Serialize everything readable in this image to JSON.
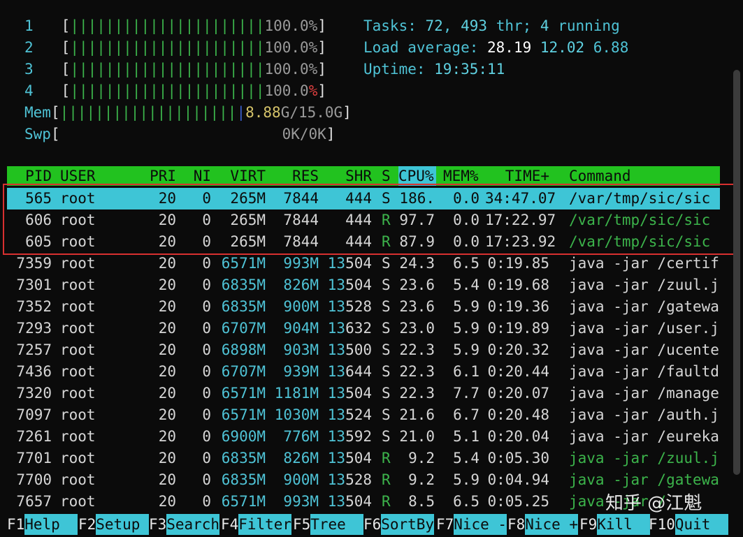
{
  "cpus": [
    {
      "label": "1",
      "bar": "||||||||||||||||||||||",
      "pct": "100.0%"
    },
    {
      "label": "2",
      "bar": "||||||||||||||||||||||",
      "pct": "100.0%"
    },
    {
      "label": "3",
      "bar": "||||||||||||||||||||||",
      "pct": "100.0%"
    },
    {
      "label": "4",
      "bar": "||||||||||||||||||||||",
      "pct_num": "100.0",
      "pct_sign": "%"
    }
  ],
  "mem": {
    "label": "Mem",
    "bar": "||||||||||||||||||||",
    "used": "8.88",
    "total": "G/15.0G"
  },
  "swp": {
    "label": "Swp",
    "value": "0K/0K"
  },
  "stats": {
    "tasks_label": "Tasks: ",
    "tasks": "72",
    "comma": ", ",
    "threads": "493",
    "thr_label": " thr; ",
    "running": "4",
    "running_label": " running",
    "load_label": "Load average: ",
    "load1": "28.19",
    "load5": "12.02",
    "load15": "6.88",
    "uptime_label": "Uptime: ",
    "uptime": "19:35:11"
  },
  "columns": [
    "PID",
    "USER",
    "PRI",
    "NI",
    "VIRT",
    "RES",
    "SHR",
    "S",
    "CPU%",
    "MEM%",
    "TIME+",
    "Command"
  ],
  "processes": [
    {
      "pid": "565",
      "user": "root",
      "pri": "20",
      "ni": "0",
      "virt": "265M",
      "res": "7844",
      "shr": "444",
      "s": "S",
      "cpu": "186.",
      "mem": "0.0",
      "time": "34:47.07",
      "cmd": "/var/tmp/sic/sic"
    },
    {
      "pid": "606",
      "user": "root",
      "pri": "20",
      "ni": "0",
      "virt": "265M",
      "res": "7844",
      "shr": "444",
      "s": "R",
      "cpu": "97.7",
      "mem": "0.0",
      "time": "17:22.97",
      "cmd": "/var/tmp/sic/sic"
    },
    {
      "pid": "605",
      "user": "root",
      "pri": "20",
      "ni": "0",
      "virt": "265M",
      "res": "7844",
      "shr": "444",
      "s": "R",
      "cpu": "87.9",
      "mem": "0.0",
      "time": "17:23.92",
      "cmd": "/var/tmp/sic/sic"
    },
    {
      "pid": "7359",
      "user": "root",
      "pri": "20",
      "ni": "0",
      "virt": "6571M",
      "res": "993M",
      "shr": "13504",
      "s": "S",
      "cpu": "24.3",
      "mem": "6.5",
      "time": "0:19.85",
      "cmd": "java -jar /certif"
    },
    {
      "pid": "7301",
      "user": "root",
      "pri": "20",
      "ni": "0",
      "virt": "6835M",
      "res": "826M",
      "shr": "13504",
      "s": "S",
      "cpu": "23.6",
      "mem": "5.4",
      "time": "0:19.68",
      "cmd": "java -jar /zuul.j"
    },
    {
      "pid": "7352",
      "user": "root",
      "pri": "20",
      "ni": "0",
      "virt": "6835M",
      "res": "900M",
      "shr": "13528",
      "s": "S",
      "cpu": "23.6",
      "mem": "5.9",
      "time": "0:19.36",
      "cmd": "java -jar /gatewa"
    },
    {
      "pid": "7293",
      "user": "root",
      "pri": "20",
      "ni": "0",
      "virt": "6707M",
      "res": "904M",
      "shr": "13632",
      "s": "S",
      "cpu": "23.0",
      "mem": "5.9",
      "time": "0:19.89",
      "cmd": "java -jar /user.j"
    },
    {
      "pid": "7257",
      "user": "root",
      "pri": "20",
      "ni": "0",
      "virt": "6898M",
      "res": "903M",
      "shr": "13500",
      "s": "S",
      "cpu": "22.3",
      "mem": "5.9",
      "time": "0:20.32",
      "cmd": "java -jar /ucente"
    },
    {
      "pid": "7436",
      "user": "root",
      "pri": "20",
      "ni": "0",
      "virt": "6707M",
      "res": "939M",
      "shr": "13644",
      "s": "S",
      "cpu": "22.3",
      "mem": "6.1",
      "time": "0:20.44",
      "cmd": "java -jar /faultd"
    },
    {
      "pid": "7320",
      "user": "root",
      "pri": "20",
      "ni": "0",
      "virt": "6571M",
      "res": "1181M",
      "shr": "13504",
      "s": "S",
      "cpu": "22.3",
      "mem": "7.7",
      "time": "0:20.07",
      "cmd": "java -jar /manage"
    },
    {
      "pid": "7097",
      "user": "root",
      "pri": "20",
      "ni": "0",
      "virt": "6571M",
      "res": "1030M",
      "shr": "13524",
      "s": "S",
      "cpu": "21.6",
      "mem": "6.7",
      "time": "0:20.48",
      "cmd": "java -jar /auth.j"
    },
    {
      "pid": "7261",
      "user": "root",
      "pri": "20",
      "ni": "0",
      "virt": "6900M",
      "res": "776M",
      "shr": "13592",
      "s": "S",
      "cpu": "21.0",
      "mem": "5.1",
      "time": "0:20.04",
      "cmd": "java -jar /eureka"
    },
    {
      "pid": "7701",
      "user": "root",
      "pri": "20",
      "ni": "0",
      "virt": "6835M",
      "res": "826M",
      "shr": "13504",
      "s": "R",
      "cpu": "9.2",
      "mem": "5.4",
      "time": "0:05.30",
      "cmd": "java -jar /zuul.j"
    },
    {
      "pid": "7700",
      "user": "root",
      "pri": "20",
      "ni": "0",
      "virt": "6835M",
      "res": "900M",
      "shr": "13528",
      "s": "R",
      "cpu": "9.2",
      "mem": "5.9",
      "time": "0:04.94",
      "cmd": "java -jar /gatewa"
    },
    {
      "pid": "7657",
      "user": "root",
      "pri": "20",
      "ni": "0",
      "virt": "6571M",
      "res": "993M",
      "shr": "13504",
      "s": "R",
      "cpu": "8.5",
      "mem": "6.5",
      "time": "0:05.25",
      "cmd": "java -jar /"
    }
  ],
  "footer": [
    {
      "key": "F1",
      "label": "Help  "
    },
    {
      "key": "F2",
      "label": "Setup "
    },
    {
      "key": "F3",
      "label": "Search"
    },
    {
      "key": "F4",
      "label": "Filter"
    },
    {
      "key": "F5",
      "label": "Tree  "
    },
    {
      "key": "F6",
      "label": "SortBy"
    },
    {
      "key": "F7",
      "label": "Nice -"
    },
    {
      "key": "F8",
      "label": "Nice +"
    },
    {
      "key": "F9",
      "label": "Kill  "
    },
    {
      "key": "F10",
      "label": "Quit  "
    }
  ],
  "watermark": "知乎 @江魁",
  "colors": {
    "header_bg": "#22c21f",
    "selection_bg": "#3ec5d6",
    "highlight_box": "#d83030"
  }
}
